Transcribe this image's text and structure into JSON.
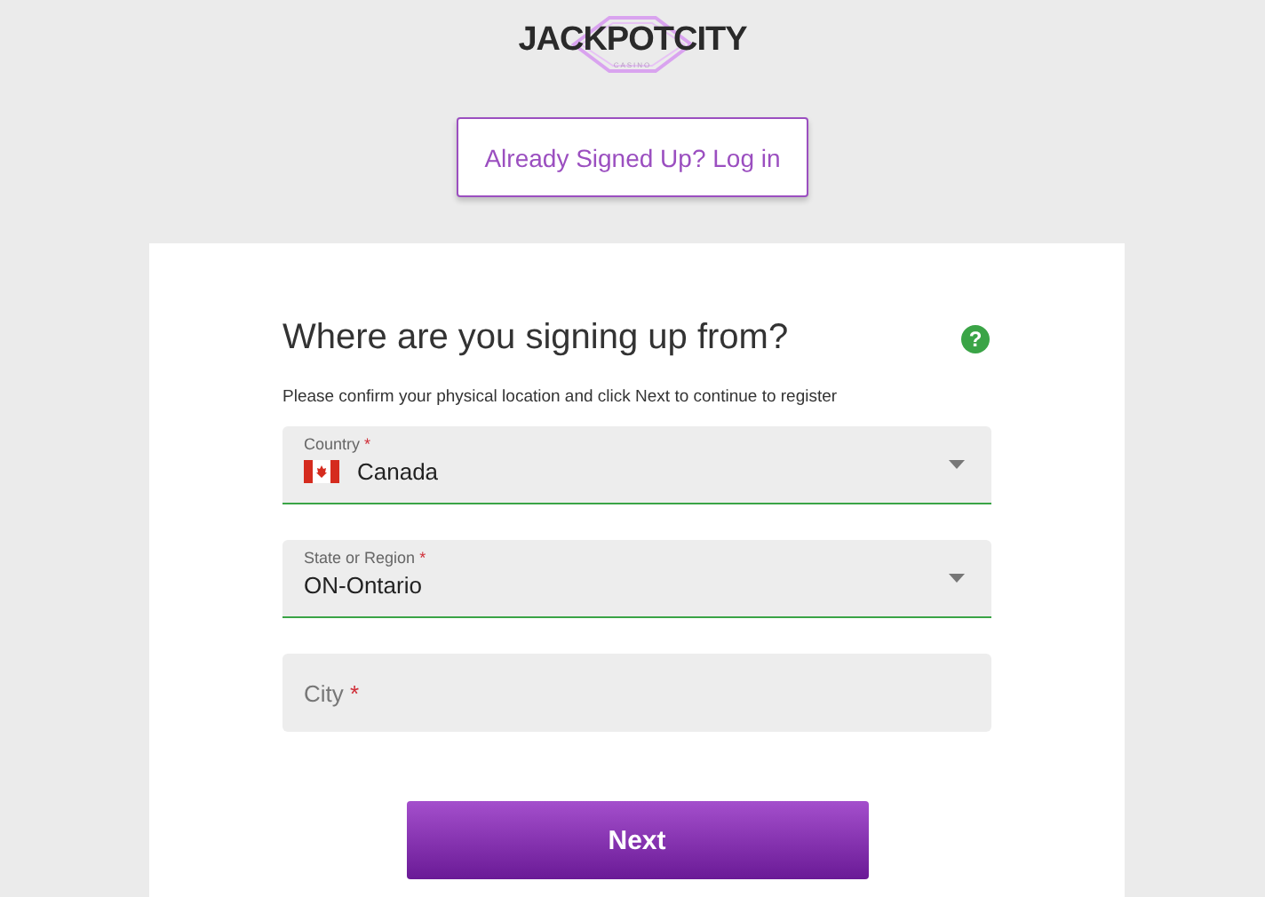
{
  "logo": {
    "name": "JACKPOTCITY",
    "tagline": "CASINO"
  },
  "login_button": {
    "label": "Already Signed Up? Log in"
  },
  "form": {
    "title": "Where are you signing up from?",
    "help": "?",
    "subtitle": "Please confirm your physical location and click Next to continue to register",
    "fields": [
      {
        "kind": "select",
        "label": "Country",
        "required_mark": "*",
        "value": "Canada",
        "flag": true
      },
      {
        "kind": "select",
        "label": "State or Region",
        "required_mark": "*",
        "value": "ON-Ontario",
        "flag": false
      },
      {
        "kind": "text",
        "placeholder": "City",
        "required_mark": "*"
      }
    ],
    "submit": {
      "label": "Next"
    }
  }
}
